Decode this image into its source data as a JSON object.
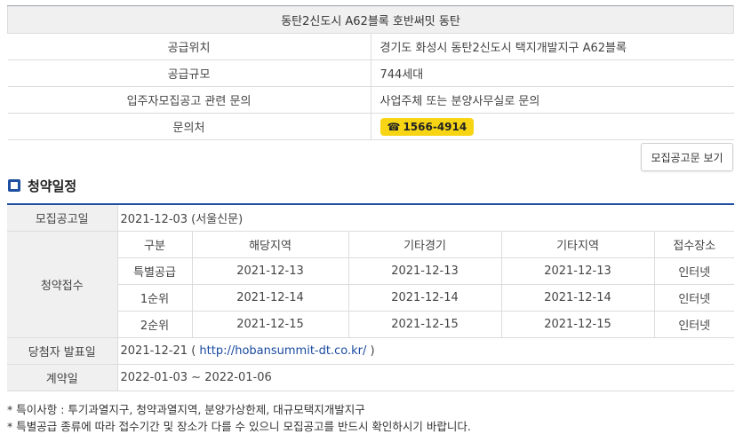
{
  "info": {
    "title": "동탄2신도시 A62블록 호반써밋 동탄",
    "rows": [
      {
        "label": "공급위치",
        "value": "경기도 화성시 동탄2신도시 택지개발지구 A62블록"
      },
      {
        "label": "공급규모",
        "value": "744세대"
      },
      {
        "label": "입주자모집공고 관련 문의",
        "value": "사업주체 또는 분양사무실로 문의"
      },
      {
        "label": "문의처",
        "value": "1566-4914"
      }
    ],
    "phone_glyph": "☎"
  },
  "buttons": {
    "notice": "모집공고문 보기"
  },
  "section": {
    "title": "청약일정"
  },
  "schedule": {
    "announcement_label": "모집공고일",
    "announcement_value": "2021-12-03 (서울신문)",
    "application_label": "청약접수",
    "columns": [
      "구분",
      "해당지역",
      "기타경기",
      "기타지역",
      "접수장소"
    ],
    "rows": [
      [
        "특별공급",
        "2021-12-13",
        "2021-12-13",
        "2021-12-13",
        "인터넷"
      ],
      [
        "1순위",
        "2021-12-14",
        "2021-12-14",
        "2021-12-14",
        "인터넷"
      ],
      [
        "2순위",
        "2021-12-15",
        "2021-12-15",
        "2021-12-15",
        "인터넷"
      ]
    ],
    "winner_label": "당첨자 발표일",
    "winner_date": "2021-12-21",
    "winner_link": "http://hobansummit-dt.co.kr/",
    "contract_label": "계약일",
    "contract_value": "2022-01-03 ~ 2022-01-06"
  },
  "notes": [
    "* 특이사항 : 투기과열지구, 청약과열지역, 분양가상한제, 대규모택지개발지구",
    "* 특별공급 종류에 따라 접수기간 및 장소가 다를 수 있으니 모집공고를 반드시 확인하시기 바랍니다."
  ],
  "colors": {
    "accent": "#1f4fa0",
    "badge": "#f7d515",
    "header_bg": "#f0f0f0"
  }
}
